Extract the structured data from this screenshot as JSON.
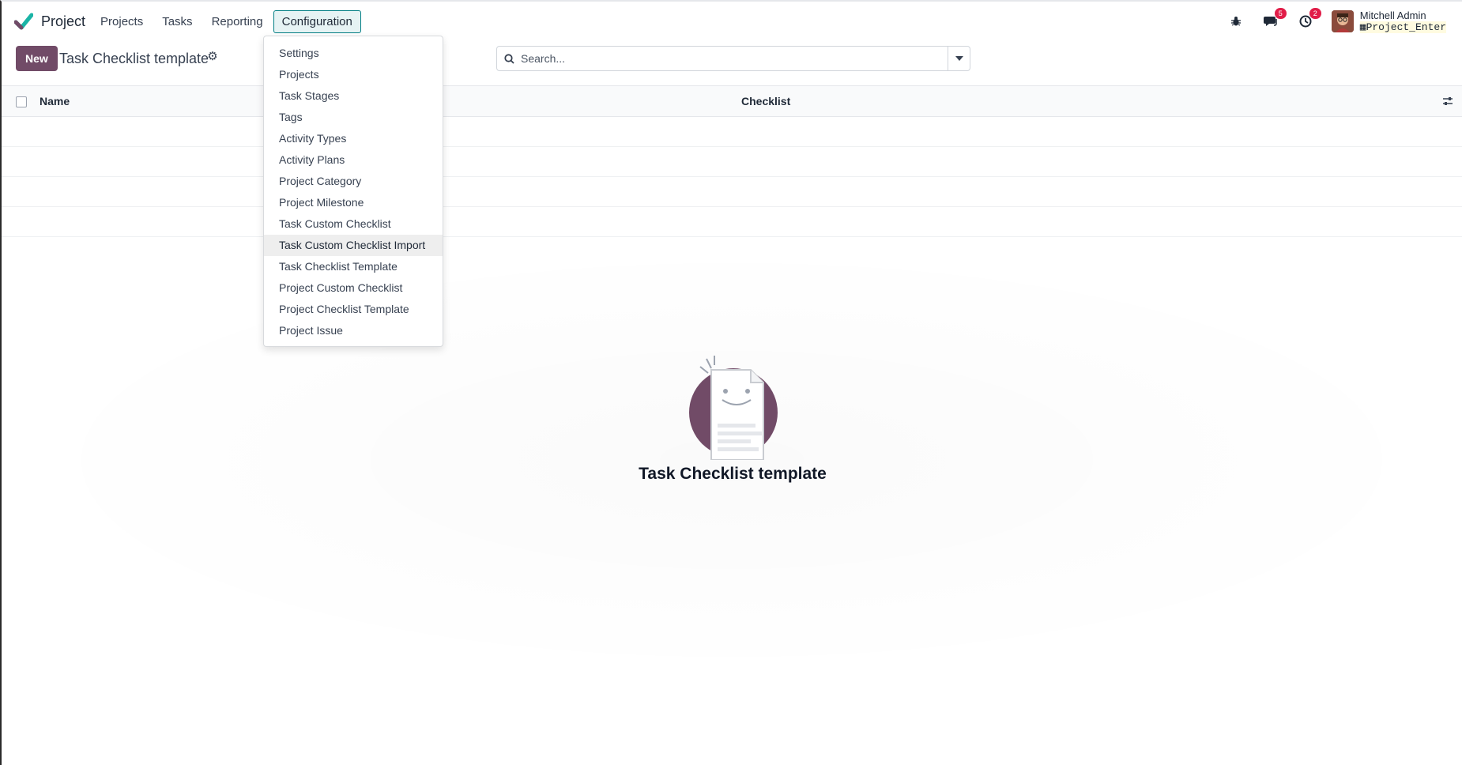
{
  "navbar": {
    "app_name": "Project",
    "menu": [
      "Projects",
      "Tasks",
      "Reporting",
      "Configuration"
    ],
    "active_menu": "Configuration",
    "badges": {
      "messages": "5",
      "activities": "2"
    },
    "user": {
      "name": "Mitchell Admin",
      "database": "Project_Enter"
    }
  },
  "control_panel": {
    "new_label": "New",
    "title": "Task Checklist template",
    "search_placeholder": "Search..."
  },
  "list": {
    "columns": [
      "Name",
      "Checklist"
    ]
  },
  "empty_state": {
    "title": "Task Checklist template"
  },
  "config_menu": {
    "items": [
      "Settings",
      "Projects",
      "Task Stages",
      "Tags",
      "Activity Types",
      "Activity Plans",
      "Project Category",
      "Project Milestone",
      "Task Custom Checklist",
      "Task Custom Checklist Import",
      "Task Checklist Template",
      "Project Custom Checklist",
      "Project Checklist Template",
      "Project Issue"
    ],
    "hovered_index": 9
  },
  "colors": {
    "brand": "#714b67",
    "active_menu_border": "#017e84",
    "badge": "#e11d48"
  },
  "icons": [
    "app-logo-icon",
    "settings-gear-icon",
    "search-icon",
    "caret-down-icon",
    "bug-icon",
    "chat-icon",
    "clock-icon",
    "column-options-icon"
  ]
}
